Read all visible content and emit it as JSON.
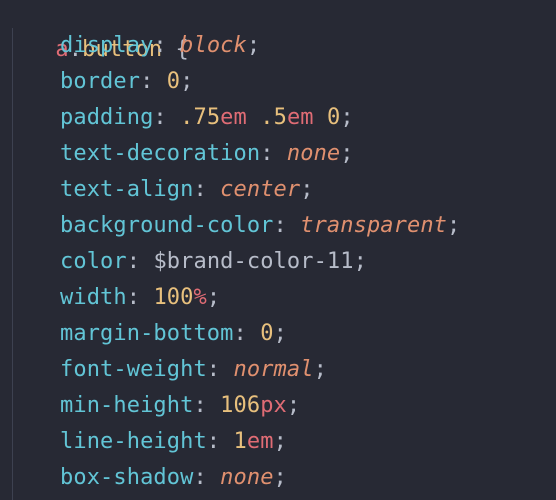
{
  "theme": {
    "background": "#272934",
    "property_color": "#62c5d6",
    "keyword_color": "#e0906f",
    "number_color": "#e8c07d",
    "selector_color": "#e06c75",
    "text_color": "#b7bcc9"
  },
  "selector": {
    "tag": "a",
    "dot": ".",
    "class": "button",
    "brace": " {"
  },
  "rules": [
    {
      "property": "display",
      "value": "block",
      "value_type": "keyword"
    },
    {
      "property": "border",
      "value": "0",
      "value_type": "number"
    },
    {
      "property": "padding",
      "value": ".75em .5em 0",
      "value_type": "mixed",
      "parts": [
        {
          "text": ".75",
          "type": "number"
        },
        {
          "text": "em",
          "type": "unit"
        },
        {
          "text": " ",
          "type": "plain"
        },
        {
          "text": ".5",
          "type": "number"
        },
        {
          "text": "em",
          "type": "unit"
        },
        {
          "text": " ",
          "type": "plain"
        },
        {
          "text": "0",
          "type": "number"
        }
      ]
    },
    {
      "property": "text-decoration",
      "value": "none",
      "value_type": "keyword"
    },
    {
      "property": "text-align",
      "value": "center",
      "value_type": "keyword"
    },
    {
      "property": "background-color",
      "value": "transparent",
      "value_type": "keyword"
    },
    {
      "property": "color",
      "value": "$brand-color-11",
      "value_type": "variable"
    },
    {
      "property": "width",
      "value": "100%",
      "value_type": "mixed",
      "parts": [
        {
          "text": "100",
          "type": "number"
        },
        {
          "text": "%",
          "type": "unit"
        }
      ]
    },
    {
      "property": "margin-bottom",
      "value": "0",
      "value_type": "number"
    },
    {
      "property": "font-weight",
      "value": "normal",
      "value_type": "keyword"
    },
    {
      "property": "min-height",
      "value": "106px",
      "value_type": "mixed",
      "parts": [
        {
          "text": "106",
          "type": "number"
        },
        {
          "text": "px",
          "type": "unit"
        }
      ]
    },
    {
      "property": "line-height",
      "value": "1em",
      "value_type": "mixed",
      "parts": [
        {
          "text": "1",
          "type": "number"
        },
        {
          "text": "em",
          "type": "unit"
        }
      ]
    },
    {
      "property": "box-shadow",
      "value": "none",
      "value_type": "keyword"
    }
  ]
}
